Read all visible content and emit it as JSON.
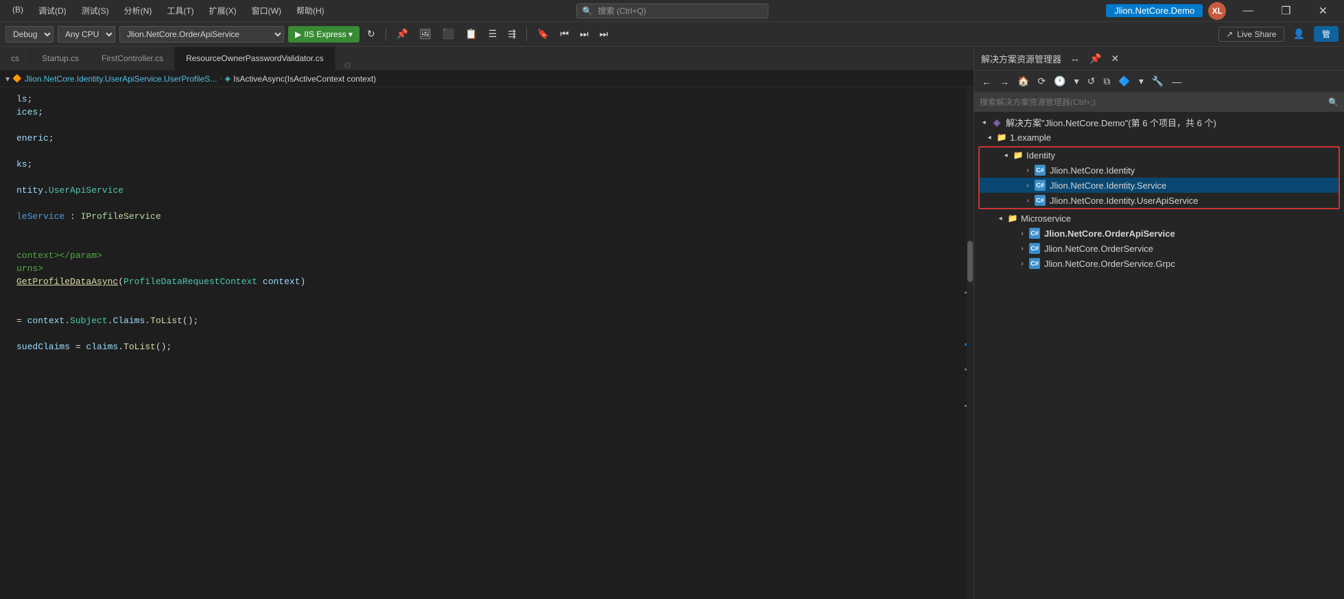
{
  "titleBar": {
    "menus": [
      "(B)",
      "调试(D)",
      "测试(S)",
      "分析(N)",
      "工具(T)",
      "扩展(X)",
      "窗口(W)",
      "帮助(H)"
    ],
    "searchPlaceholder": "搜索 (Ctrl+Q)",
    "appTitle": "Jlion.NetCore.Demo",
    "avatar": "XL",
    "winBtns": [
      "—",
      "❐",
      "✕"
    ]
  },
  "toolbar": {
    "debugMode": "Debug",
    "platform": "Any CPU",
    "project": "Jlion.NetCore.OrderApiService",
    "runLabel": "▶ IIS Express",
    "liveShare": "Live Share"
  },
  "tabs": [
    {
      "label": "cs",
      "active": false
    },
    {
      "label": "Startup.cs",
      "active": false
    },
    {
      "label": "FirstController.cs",
      "active": false
    },
    {
      "label": "ResourceOwnerPasswordValidator.cs",
      "active": true
    }
  ],
  "breadcrumb": {
    "namespace": "Jlion.NetCore.Identity.UserApiService.UserProfileS...",
    "method": "IsActiveAsync(IsActiveContext context)"
  },
  "codeLines": [
    {
      "text": "ls;",
      "indent": 0,
      "style": ""
    },
    {
      "text": "ices;",
      "indent": 0,
      "style": ""
    },
    {
      "text": "",
      "indent": 0,
      "style": ""
    },
    {
      "text": "eneric;",
      "indent": 0,
      "style": ""
    },
    {
      "text": "",
      "indent": 0,
      "style": ""
    },
    {
      "text": "ks;",
      "indent": 0,
      "style": ""
    },
    {
      "text": "",
      "indent": 0,
      "style": ""
    },
    {
      "text": "ntity.UserApiService",
      "indent": 0,
      "style": ""
    },
    {
      "text": "",
      "indent": 0,
      "style": ""
    },
    {
      "text": "leService : IProfileService",
      "indent": 0,
      "style": "interface"
    },
    {
      "text": "",
      "indent": 0,
      "style": ""
    },
    {
      "text": "",
      "indent": 0,
      "style": ""
    },
    {
      "text": "context\"></param>",
      "indent": 0,
      "style": "comment"
    },
    {
      "text": "urns>",
      "indent": 0,
      "style": "comment"
    },
    {
      "text": "GetProfileDataAsync(ProfileDataRequestContext context)",
      "indent": 0,
      "style": "method underline"
    },
    {
      "text": "",
      "indent": 0,
      "style": ""
    },
    {
      "text": "",
      "indent": 0,
      "style": ""
    },
    {
      "text": "= context.Subject.Claims.ToList();",
      "indent": 0,
      "style": ""
    },
    {
      "text": "",
      "indent": 0,
      "style": ""
    },
    {
      "text": "suedClaims = claims.ToList();",
      "indent": 0,
      "style": ""
    }
  ],
  "solutionExplorer": {
    "title": "解决方案资源管理器",
    "searchPlaceholder": "搜索解决方案资源管理器(Ctrl+;)",
    "solutionLabel": "解决方案\"Jlion.NetCore.Demo\"(第 6 个项目，共 6 个)",
    "tree": [
      {
        "label": "1.example",
        "level": 1,
        "type": "folder",
        "expanded": true
      },
      {
        "label": "Identity",
        "level": 2,
        "type": "folder",
        "expanded": true,
        "redBorder": true
      },
      {
        "label": "Jlion.NetCore.Identity",
        "level": 3,
        "type": "project",
        "redBorder": true
      },
      {
        "label": "Jlion.NetCore.Identity.Service",
        "level": 3,
        "type": "project",
        "redBorder": true,
        "selected": true
      },
      {
        "label": "Jlion.NetCore.Identity.UserApiService",
        "level": 3,
        "type": "project",
        "redBorder": true
      },
      {
        "label": "Microservice",
        "level": 2,
        "type": "folder",
        "expanded": false
      },
      {
        "label": "Jlion.NetCore.OrderApiService",
        "level": 3,
        "type": "project",
        "bold": true
      },
      {
        "label": "Jlion.NetCore.OrderService",
        "level": 3,
        "type": "project"
      },
      {
        "label": "Jlion.NetCore.OrderService.Grpc",
        "level": 3,
        "type": "project"
      }
    ]
  },
  "icons": {
    "search": "🔍",
    "play": "▶",
    "refresh": "↻",
    "pin": "📌",
    "settings": "⚙",
    "chevronRight": "›",
    "chevronDown": "▾",
    "folder": "📁",
    "share": "↗"
  }
}
